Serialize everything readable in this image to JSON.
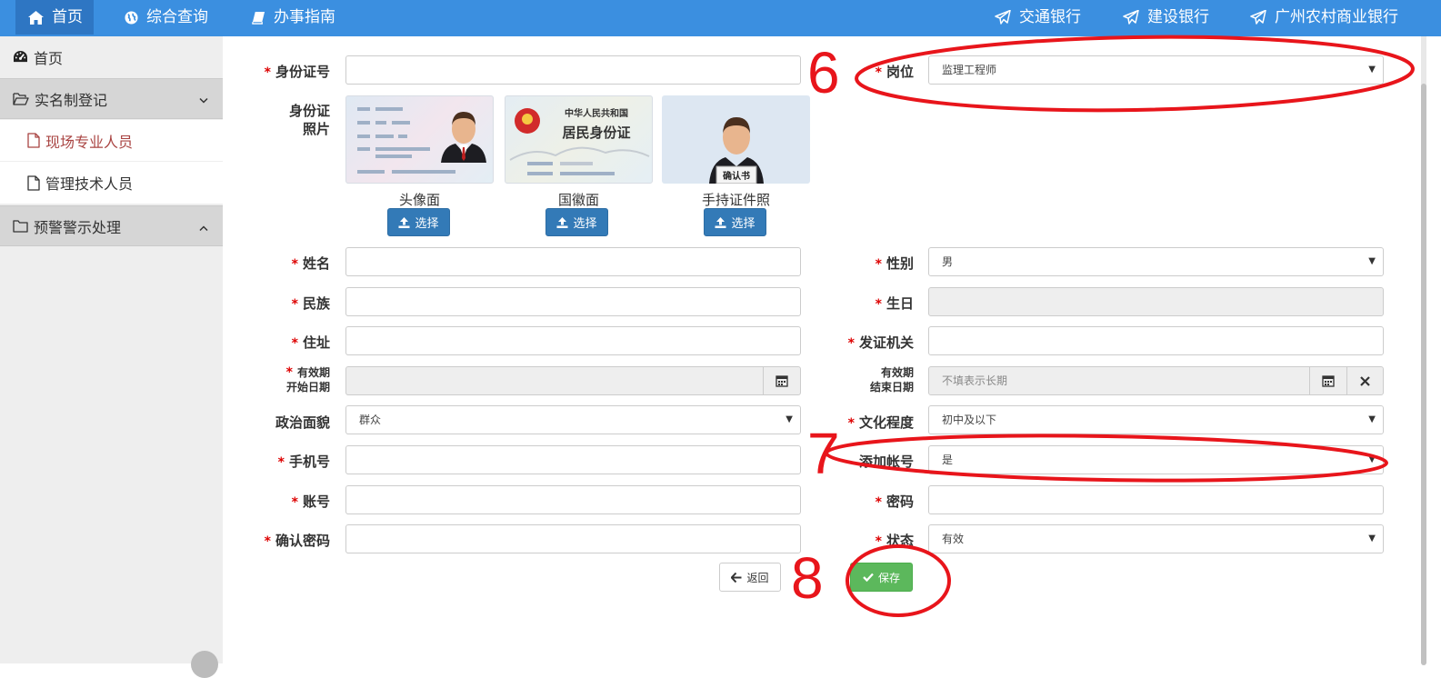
{
  "topnav": {
    "left": [
      {
        "label": "首页",
        "icon": "home-icon"
      },
      {
        "label": "综合查询",
        "icon": "globe-icon"
      },
      {
        "label": "办事指南",
        "icon": "book-icon"
      }
    ],
    "right": [
      {
        "label": "交通银行",
        "icon": "send-icon"
      },
      {
        "label": "建设银行",
        "icon": "send-icon"
      },
      {
        "label": "广州农村商业银行",
        "icon": "send-icon"
      }
    ]
  },
  "sidebar": {
    "home": "首页",
    "group1": "实名制登记",
    "group1_items": [
      "现场专业人员",
      "管理技术人员"
    ],
    "group2": "预警警示处理"
  },
  "form": {
    "id_number": {
      "label": "身份证号",
      "value": ""
    },
    "position": {
      "label": "岗位",
      "value": "监理工程师"
    },
    "photos": {
      "label_line1": "身份证",
      "label_line2": "照片",
      "items": [
        {
          "caption": "头像面",
          "button": "选择",
          "card_title1": "中华人民共和国",
          "card_title2": "居民身份证",
          "card_note": "确认书"
        },
        {
          "caption": "国徽面",
          "button": "选择"
        },
        {
          "caption": "手持证件照",
          "button": "选择"
        }
      ],
      "back_title1": "中华人民共和国",
      "back_title2": "居民身份证",
      "held_card": "确认书"
    },
    "name": {
      "label": "姓名",
      "value": ""
    },
    "gender": {
      "label": "性别",
      "value": "男"
    },
    "ethnicity": {
      "label": "民族",
      "value": ""
    },
    "birthday": {
      "label": "生日",
      "value": ""
    },
    "address": {
      "label": "住址",
      "value": ""
    },
    "issuer": {
      "label": "发证机关",
      "value": ""
    },
    "valid_start": {
      "label_line1": "有效期",
      "label_line2": "开始日期",
      "value": ""
    },
    "valid_end": {
      "label_line1": "有效期",
      "label_line2": "结束日期",
      "placeholder": "不填表示长期"
    },
    "political": {
      "label": "政治面貌",
      "value": "群众"
    },
    "education": {
      "label": "文化程度",
      "value": "初中及以下"
    },
    "phone": {
      "label": "手机号",
      "value": ""
    },
    "add_account": {
      "label": "添加帐号",
      "value": "是"
    },
    "account": {
      "label": "账号",
      "value": ""
    },
    "password": {
      "label": "密码",
      "value": ""
    },
    "confirm_password": {
      "label": "确认密码",
      "value": ""
    },
    "status": {
      "label": "状态",
      "value": "有效"
    },
    "back_button": "返回",
    "save_button": "保存"
  },
  "annotations": {
    "a6": "6",
    "a7": "7",
    "a8": "8",
    "color": "#e8151b"
  },
  "colors": {
    "nav_bg": "#3b8fe0",
    "primary": "#337ab7",
    "success": "#5cb85c",
    "required": "#dd0000"
  }
}
